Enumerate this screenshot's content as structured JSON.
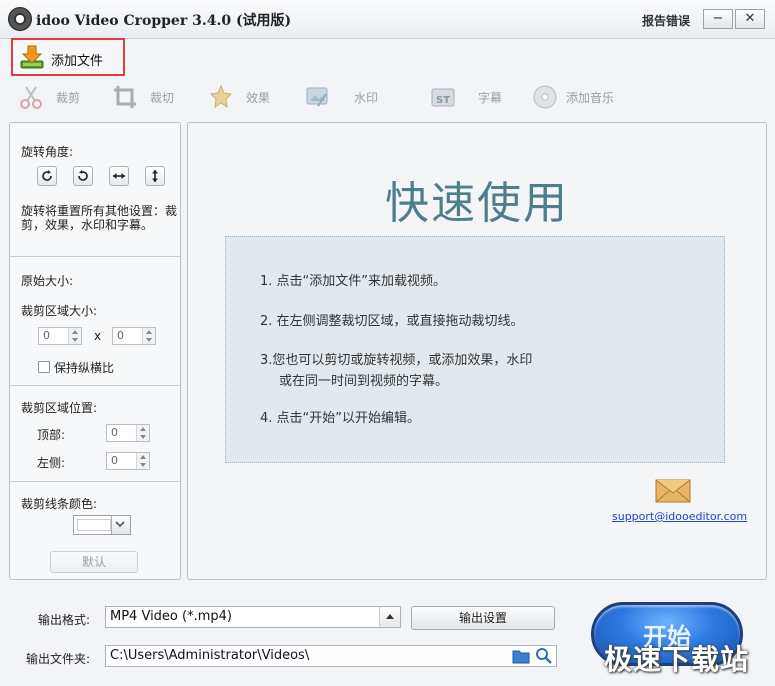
{
  "window": {
    "title": "idoo Video Cropper 3.4.0 (试用版)",
    "report_link": "报告错误",
    "minimize_glyph": "−",
    "close_glyph": "✕"
  },
  "add_file": {
    "label": "添加文件",
    "icon": "download-arrow-icon"
  },
  "toolbar": [
    {
      "label": "裁剪",
      "icon": "scissors-icon"
    },
    {
      "label": "裁切",
      "icon": "crop-icon"
    },
    {
      "label": "效果",
      "icon": "sparkle-star-icon"
    },
    {
      "label": "水印",
      "icon": "watermark-icon"
    },
    {
      "label": "字幕",
      "icon": "subtitle-icon"
    },
    {
      "label": "添加音乐",
      "icon": "music-disc-icon"
    }
  ],
  "left_panel": {
    "rotate_label": "旋转角度:",
    "rotate_note_line1": "旋转将重置所有其他设置：裁",
    "rotate_note_line2": "剪，效果，水印和字幕。",
    "original_size_label": "原始大小:",
    "crop_size_label": "裁剪区域大小:",
    "width_value": "0",
    "height_value": "0",
    "times": "x",
    "keep_ratio_label": "保持纵横比",
    "keep_ratio_checked": false,
    "crop_pos_label": "裁剪区域位置:",
    "top_label": "顶部:",
    "top_value": "0",
    "left_label": "左侧:",
    "left_value": "0",
    "line_color_label": "裁剪线条颜色:",
    "line_color": "#ffffff",
    "default_button": "默认"
  },
  "main": {
    "title": "快速使用",
    "steps": [
      "1. 点击“添加文件”来加载视频。",
      "2. 在左侧调整裁切区域，或直接拖动裁切线。",
      "3.您也可以剪切或旋转视频，或添加效果，水印",
      "或在同一时间到视频的字幕。",
      "4. 点击“开始”以开始编辑。"
    ],
    "support_email": "support@idooeditor.com"
  },
  "bottom": {
    "format_label": "输出格式:",
    "format_value": "MP4 Video (*.mp4)",
    "output_settings_button": "输出设置",
    "folder_label": "输出文件夹:",
    "folder_value": "C:\\Users\\Administrator\\Videos\\",
    "start_button": "开始",
    "watermark": "极速下载站"
  },
  "colors": {
    "highlight_border": "#e23c3c",
    "title_accent": "#4e7e8c",
    "link": "#1a46c4",
    "start_blue": "#2d7be0"
  }
}
